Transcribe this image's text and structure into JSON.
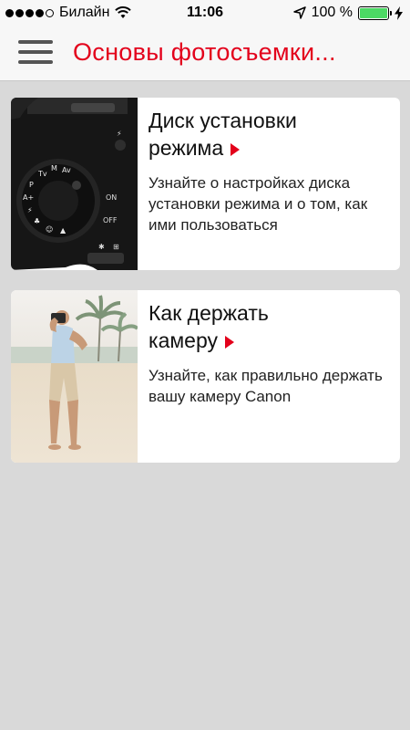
{
  "status_bar": {
    "carrier": "Билайн",
    "time": "11:06",
    "battery": "100 %"
  },
  "nav": {
    "title": "Основы фотосъемки..."
  },
  "cards": [
    {
      "title_line1": "Диск установки",
      "title_line2": "режима",
      "description": "Узнайте о настройках диска установки режима и о том, как ими пользоваться",
      "thumbnail_icon": "camera-mode-dial-photo"
    },
    {
      "title_line1": "Как держать",
      "title_line2": "камеру",
      "description": "Узнайте, как правильно держать вашу камеру Canon",
      "thumbnail_icon": "photographer-on-beach-photo"
    }
  ],
  "colors": {
    "accent": "#e3001b",
    "background": "#d9d9d9",
    "battery_fill": "#4cd964"
  }
}
